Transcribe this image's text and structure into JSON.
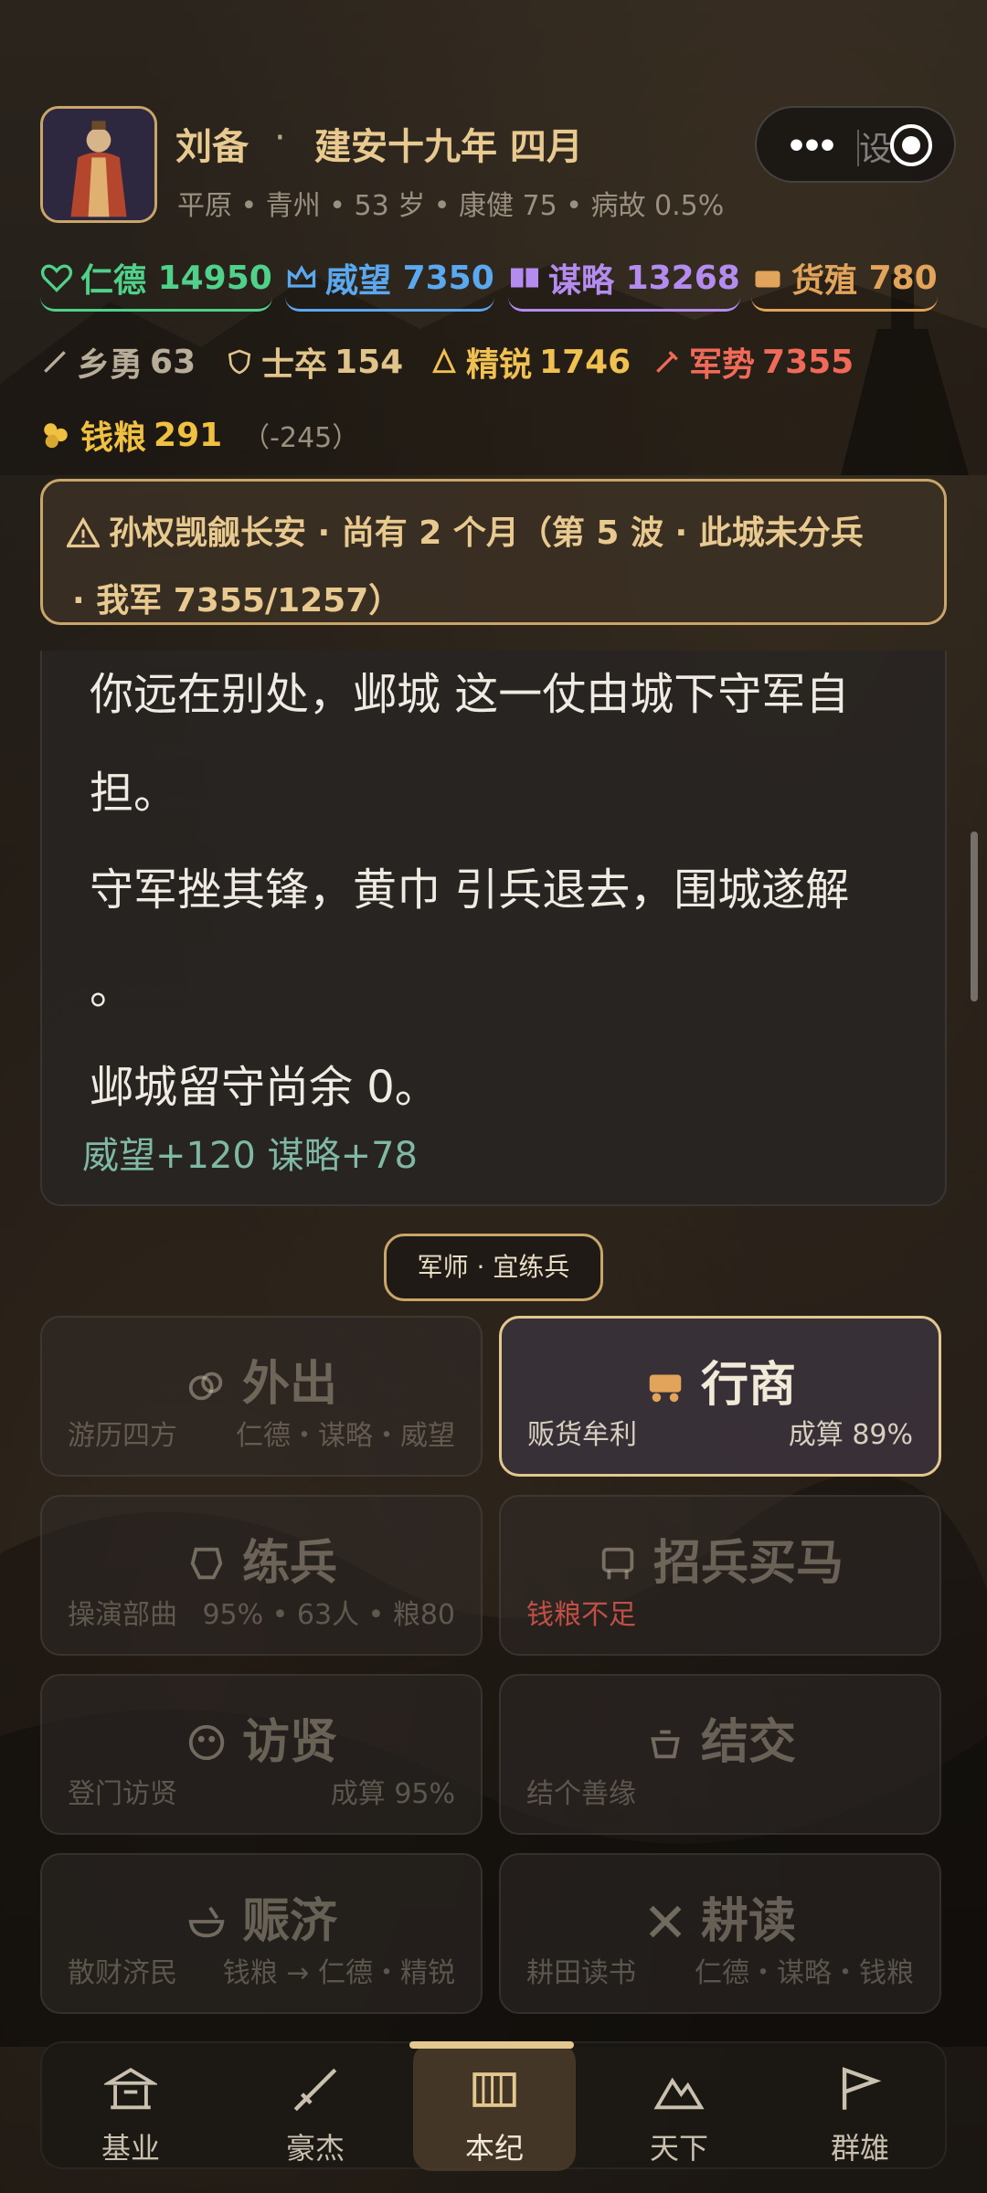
{
  "header": {
    "name": "刘备",
    "dot": "·",
    "era": "建安十九年 四月",
    "subline": "平原 • 青州 • 53 岁 • 康健 75 • 病故 0.5%"
  },
  "capsule": {
    "more": "•••",
    "partial_text": "设"
  },
  "stats_row1": [
    {
      "label": "仁德",
      "value": "14950",
      "color": "#4fd18a"
    },
    {
      "label": "威望",
      "value": "7350",
      "color": "#5aa9f0"
    },
    {
      "label": "谋略",
      "value": "13268",
      "color": "#b48cf0"
    },
    {
      "label": "货殖",
      "value": "780",
      "color": "#e2a35a"
    }
  ],
  "stats_row2": [
    {
      "label": "乡勇",
      "value": "63",
      "color": "#b8ad98"
    },
    {
      "label": "士卒",
      "value": "154",
      "color": "#e0c48a"
    },
    {
      "label": "精锐",
      "value": "1746",
      "color": "#f0c050"
    },
    {
      "label": "军势",
      "value": "7355",
      "color": "#f06a5a"
    }
  ],
  "grain": {
    "label": "钱粮",
    "value": "291",
    "delta": "（-245）",
    "color": "#f0c040"
  },
  "alert": {
    "line1": "孙权觊觎长安 · 尚有 2 个月（第 5 波 · 此城未分兵",
    "line2": "· 我军 7355/1257）"
  },
  "story": {
    "lines": [
      "你远在别处，邺城 这一仗由城下守军自",
      "担。",
      "守军挫其锋，黄巾 引兵退去，围城遂解",
      "。",
      "邺城留守尚余 0。"
    ],
    "gain": "威望+120 谋略+78"
  },
  "advisor": "军师 · 宜练兵",
  "actions": [
    {
      "title": "外出",
      "left": "游历四方",
      "right": "仁德・谋略・威望",
      "active": false
    },
    {
      "title": "行商",
      "left": "贩货牟利",
      "right": "成算 89%",
      "active": true
    },
    {
      "title": "练兵",
      "left": "操演部曲",
      "right": "95% • 63人 • 粮80",
      "active": false
    },
    {
      "title": "招兵买马",
      "left": "钱粮不足",
      "right": "",
      "active": false
    },
    {
      "title": "访贤",
      "left": "登门访贤",
      "right": "成算 95%",
      "active": false
    },
    {
      "title": "结交",
      "left": "结个善缘",
      "right": "",
      "active": false
    },
    {
      "title": "赈济",
      "left": "散财济民",
      "right": "钱粮 → 仁德・精锐",
      "active": false
    },
    {
      "title": "耕读",
      "left": "耕田读书",
      "right": "仁德・谋略・钱粮",
      "active": false
    }
  ],
  "nav": [
    {
      "label": "基业"
    },
    {
      "label": "豪杰"
    },
    {
      "label": "本纪",
      "selected": true
    },
    {
      "label": "天下"
    },
    {
      "label": "群雄"
    }
  ]
}
